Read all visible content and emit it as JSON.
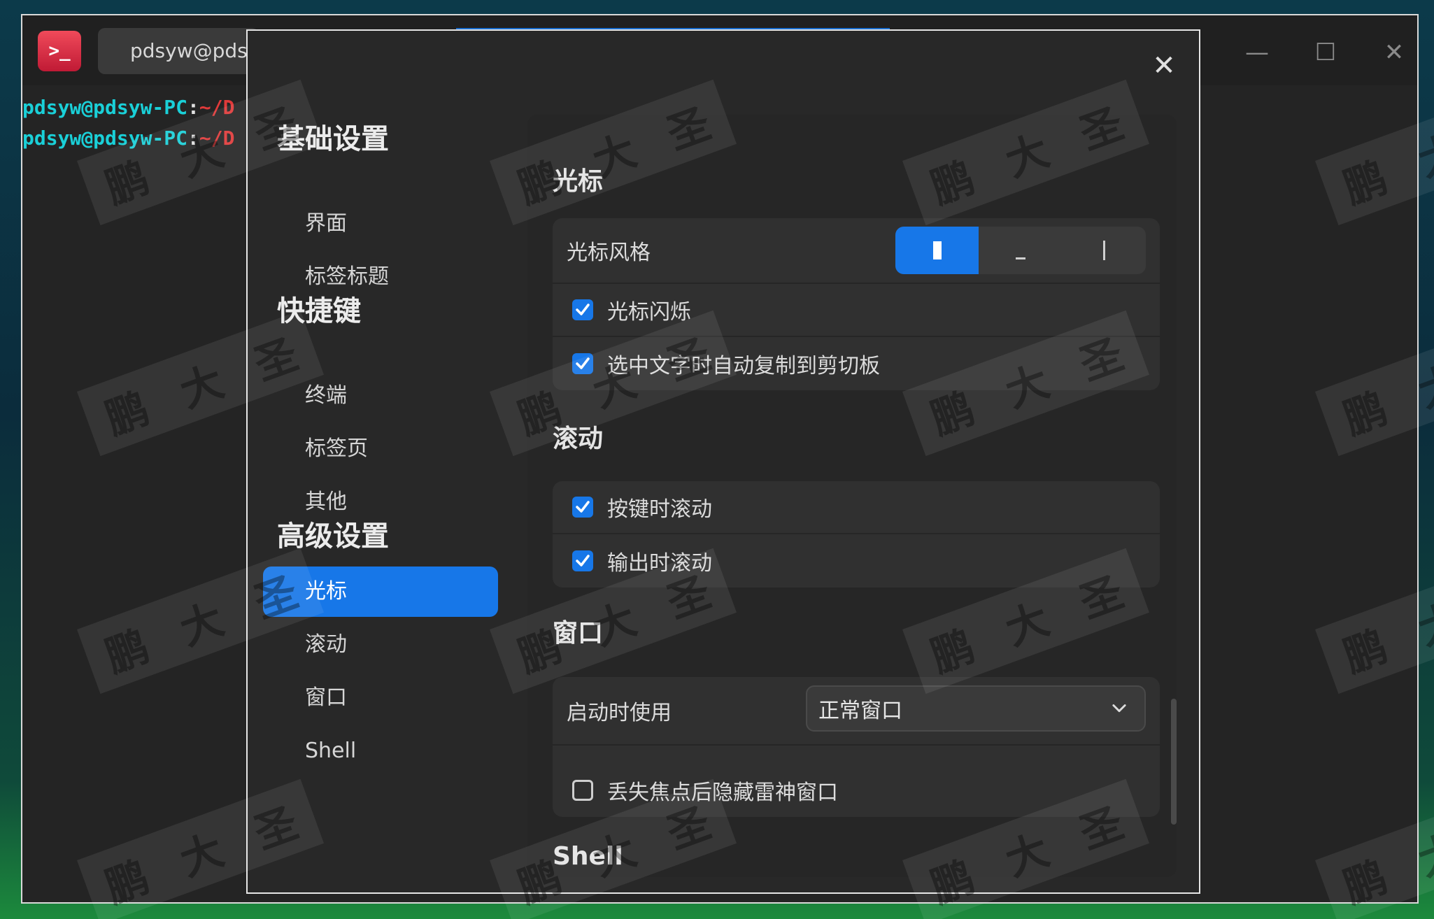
{
  "terminal": {
    "tab_title": "pdsyw@pdsyw-PC: ~/Desktop",
    "logo_glyph": ">_",
    "lines": [
      {
        "user": "pdsyw@pdsyw-PC",
        "colon": ":",
        "path": "~/D"
      },
      {
        "user": "pdsyw@pdsyw-PC",
        "colon": ":",
        "path": "~/D"
      }
    ],
    "controls": {
      "minimize": "—",
      "maximize": "☐",
      "close": "✕"
    }
  },
  "dialog": {
    "close_glyph": "✕",
    "nav": {
      "groups": [
        {
          "title": "基础设置",
          "items": [
            "界面",
            "标签标题"
          ]
        },
        {
          "title": "快捷键",
          "items": [
            "终端",
            "标签页",
            "其他"
          ]
        },
        {
          "title": "高级设置",
          "items": [
            "光标",
            "滚动",
            "窗口",
            "Shell"
          ]
        }
      ],
      "active_item": "光标"
    },
    "sections": {
      "cursor": {
        "title": "光标",
        "style_label": "光标风格",
        "style_options": [
          "block",
          "underline",
          "ibeam"
        ],
        "selected_style": "block",
        "blink_label": "光标闪烁",
        "blink_checked": true,
        "autocopy_label": "选中文字时自动复制到剪切板",
        "autocopy_checked": true
      },
      "scroll": {
        "title": "滚动",
        "on_key_label": "按键时滚动",
        "on_key_checked": true,
        "on_output_label": "输出时滚动",
        "on_output_checked": true
      },
      "window": {
        "title": "窗口",
        "startup_label": "启动时使用",
        "startup_value": "正常窗口",
        "hide_label": "丢失焦点后隐藏雷神窗口",
        "hide_checked": false
      },
      "shell": {
        "title": "Shell"
      }
    }
  },
  "watermark": {
    "chars": [
      "鹏",
      "大",
      "圣"
    ]
  },
  "colors": {
    "accent": "#1777e8",
    "prompt_user": "#1ad0d8",
    "prompt_path": "#e03a3a"
  }
}
